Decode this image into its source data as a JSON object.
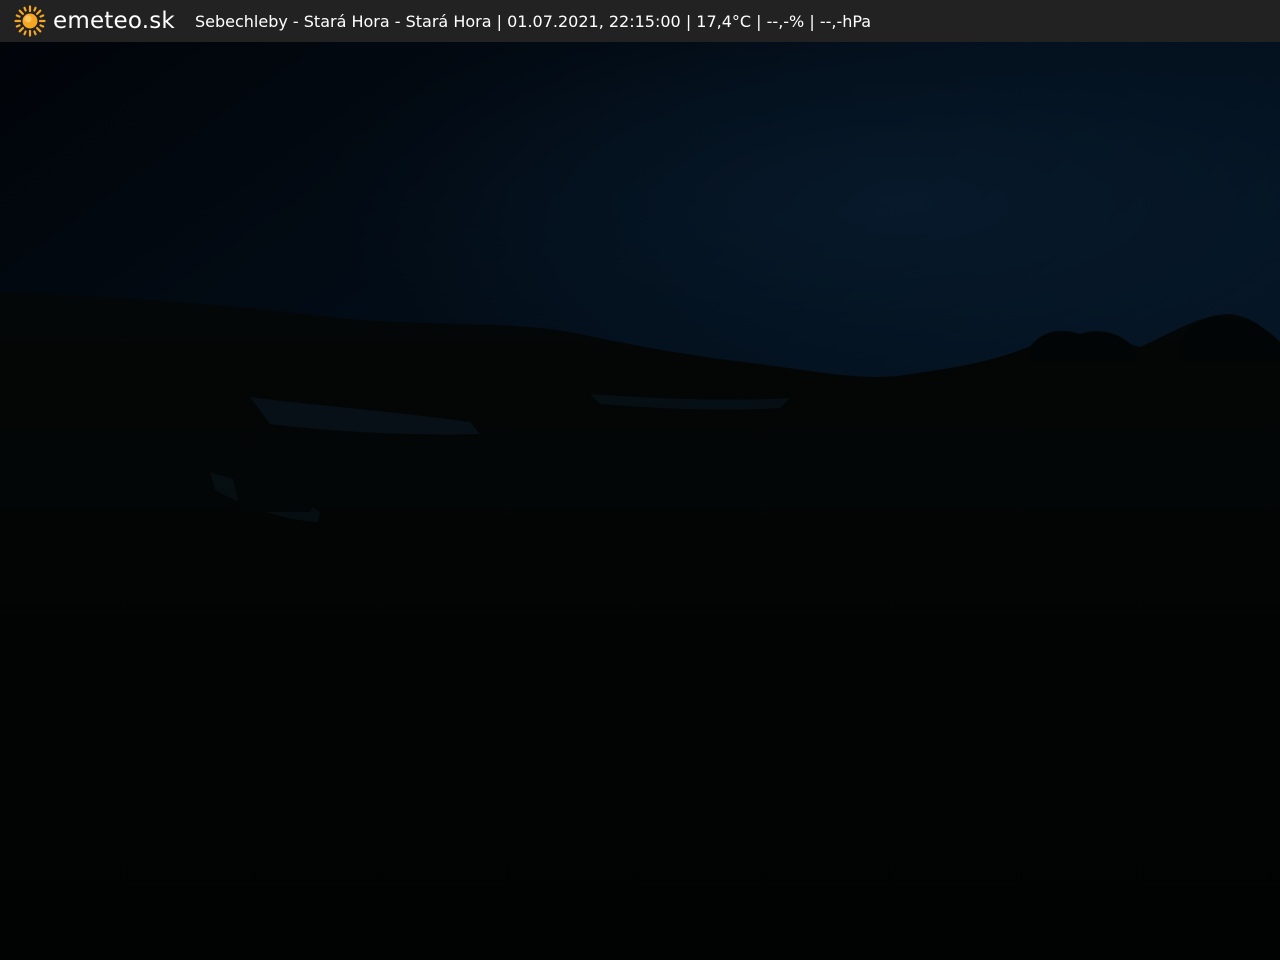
{
  "header": {
    "brand": "emeteo.sk",
    "logo_icon": "sun-icon",
    "caption": "Sebechleby - Stará Hora - Stará Hora | 01.07.2021, 22:15:00 | 17,4°C | --,-% | --,-hPa"
  },
  "colors": {
    "bar_background": "#222222",
    "sun": "#f5a623",
    "sky": "#04101d",
    "ground": "#020303"
  }
}
